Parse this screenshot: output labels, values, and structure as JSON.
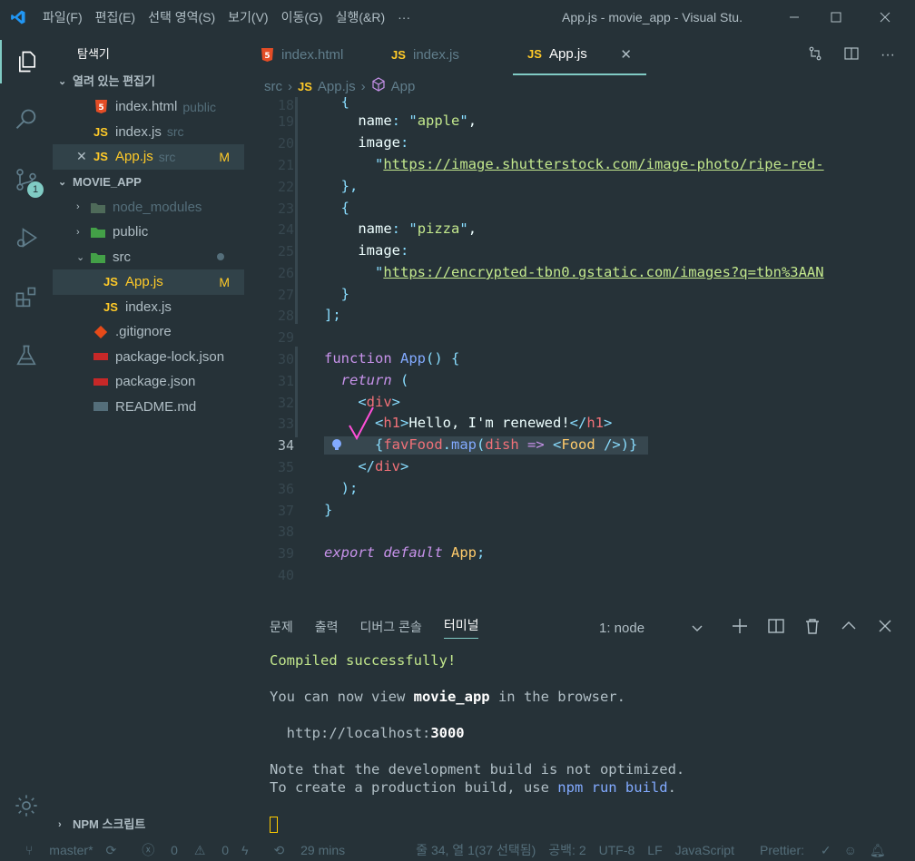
{
  "window": {
    "title": "App.js - movie_app - Visual Stu..."
  },
  "menu": [
    "파일(F)",
    "편집(E)",
    "선택 영역(S)",
    "보기(V)",
    "이동(G)",
    "실행(&R)",
    "···"
  ],
  "sidebar": {
    "title": "탐색기",
    "open_editors_label": "열려 있는 편집기",
    "open_editors": [
      {
        "icon": "html5-icon",
        "name": "index.html",
        "desc": "public",
        "mod": ""
      },
      {
        "icon": "js-icon",
        "name": "index.js",
        "desc": "src",
        "mod": ""
      },
      {
        "icon": "js-icon",
        "name": "App.js",
        "desc": "src",
        "mod": "M"
      }
    ],
    "project_label": "MOVIE_APP",
    "tree": [
      {
        "name": "node_modules",
        "kind": "folder"
      },
      {
        "name": "public",
        "kind": "folder"
      },
      {
        "name": "src",
        "kind": "folder-open"
      },
      {
        "name": "App.js",
        "kind": "js",
        "mod": "M"
      },
      {
        "name": "index.js",
        "kind": "js"
      },
      {
        "name": ".gitignore",
        "kind": "git"
      },
      {
        "name": "package-lock.json",
        "kind": "npm"
      },
      {
        "name": "package.json",
        "kind": "npm"
      },
      {
        "name": "README.md",
        "kind": "md"
      }
    ],
    "npm_label": "NPM 스크립트",
    "scm_badge": "1"
  },
  "tabs": [
    {
      "label": "index.html",
      "icon": "html5-icon"
    },
    {
      "label": "index.js",
      "icon": "JS"
    },
    {
      "label": "App.js",
      "icon": "JS",
      "active": true
    }
  ],
  "breadcrumb": {
    "folder": "src",
    "file": "App.js",
    "symbol": "App"
  },
  "editor": {
    "line_numbers": [
      "18",
      "19",
      "20",
      "21",
      "22",
      "23",
      "24",
      "25",
      "26",
      "27",
      "28",
      "29",
      "30",
      "31",
      "32",
      "33",
      "34",
      "35",
      "36",
      "37",
      "38",
      "39",
      "40"
    ],
    "url1": "https://image.shutterstock.com/image-photo/ripe-red-",
    "url2": "https://encrypted-tbn0.gstatic.com/images?q=tbn%3AAN"
  },
  "panel": {
    "tabs": [
      "문제",
      "출력",
      "디버그 콘솔",
      "터미널"
    ],
    "terminal_select": "1: node",
    "lines": {
      "compiled": "Compiled successfully!",
      "view_pre": "You can now view ",
      "view_app": "movie_app",
      "view_post": " in the browser.",
      "host_pre": "  http://localhost:",
      "host_port": "3000",
      "note1": "Note that the development build is not optimized.",
      "note2_pre": "To create a production build, use ",
      "note2_cmd": "npm run build",
      "note2_post": "."
    }
  },
  "status": {
    "branch": "master*",
    "errors": "0",
    "warnings": "0",
    "time": "29 mins",
    "position": "줄 34, 열 1(37 선택됨)",
    "spaces": "공백: 2",
    "encoding": "UTF-8",
    "eol": "LF",
    "language": "JavaScript",
    "prettier": "Prettier:"
  },
  "colors": {
    "accent": "#80cbc4",
    "bg": "#263238",
    "js": "#ffca28",
    "string": "#c3e88d",
    "keyword": "#c792ea",
    "function": "#82aaff",
    "tag": "#f07178"
  }
}
